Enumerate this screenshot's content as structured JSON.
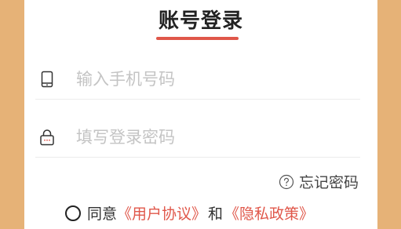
{
  "login": {
    "title": "账号登录",
    "phone_field": {
      "placeholder": "输入手机号码",
      "value": "",
      "icon": "phone-icon"
    },
    "password_field": {
      "placeholder": "填写登录密码",
      "value": "",
      "icon": "lock-icon"
    },
    "forgot_password": {
      "label": "忘记密码",
      "icon": "help-circle-icon"
    },
    "agreement": {
      "checked": false,
      "prefix": "同意",
      "user_agreement": "《用户协议》",
      "conjunction": "和",
      "privacy_policy": "《隐私政策》"
    }
  },
  "colors": {
    "background": "#e6b277",
    "accent": "#e0574a",
    "placeholder": "#c4c4c4",
    "card": "#ffffff"
  }
}
